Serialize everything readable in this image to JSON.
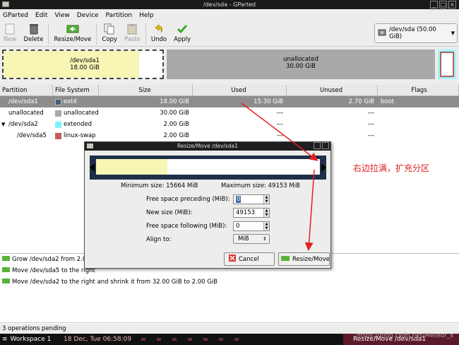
{
  "window": {
    "title": "/dev/sda - GParted"
  },
  "menu": [
    "GParted",
    "Edit",
    "View",
    "Device",
    "Partition",
    "Help"
  ],
  "toolbar": {
    "new": "New",
    "delete": "Delete",
    "resize": "Resize/Move",
    "copy": "Copy",
    "paste": "Paste",
    "undo": "Undo",
    "apply": "Apply",
    "device": "/dev/sda   (50.00 GiB)"
  },
  "graph": {
    "sda1_name": "/dev/sda1",
    "sda1_size": "18.00 GiB",
    "unalloc_name": "unallocated",
    "unalloc_size": "30.00 GiB"
  },
  "table": {
    "headers": [
      "Partition",
      "File System",
      "Size",
      "Used",
      "Unused",
      "Flags"
    ],
    "rows": [
      {
        "partition": "/dev/sda1",
        "fs": "ext4",
        "fs_color": "#435e78",
        "size": "18.00 GiB",
        "used": "15.30 GiB",
        "unused": "2.70 GiB",
        "flags": "boot"
      },
      {
        "partition": "unallocated",
        "fs": "unallocated",
        "fs_color": "#a9a9a9",
        "size": "30.00 GiB",
        "used": "---",
        "unused": "---",
        "flags": ""
      },
      {
        "partition": "/dev/sda2",
        "fs": "extended",
        "fs_color": "#7df2f8",
        "size": "2.00 GiB",
        "used": "---",
        "unused": "---",
        "flags": ""
      },
      {
        "partition": "/dev/sda5",
        "fs": "linux-swap",
        "fs_color": "#c06060",
        "size": "2.00 GiB",
        "used": "---",
        "unused": "---",
        "flags": ""
      }
    ]
  },
  "operations": [
    "Grow /dev/sda2 from 2.00",
    "Move /dev/sda5 to the right",
    "Move /dev/sda2 to the right and shrink it from 32.00 GiB to 2.00 GiB"
  ],
  "status": "3 operations pending",
  "dialog": {
    "title": "Resize/Move /dev/sda1",
    "min_size": "Minimum size: 15664 MiB",
    "max_size": "Maximum size: 49153 MiB",
    "preceding_label": "Free space preceding (MiB):",
    "preceding_value": "0",
    "newsize_label": "New size (MiB):",
    "newsize_value": "49153",
    "following_label": "Free space following (MiB):",
    "following_value": "0",
    "align_label": "Align to:",
    "align_value": "MiB",
    "cancel": "Cancel",
    "resize": "Resize/Move",
    "used_fraction": 0.32
  },
  "annotation": "右边拉满，扩充分区",
  "taskbar": {
    "workspace": "Workspace 1",
    "clock": "18 Dec, Tue 06:58:09",
    "active": "Resize/Move /dev/sda1"
  },
  "watermark": "https://blog.csdn.net/Meteor_s"
}
